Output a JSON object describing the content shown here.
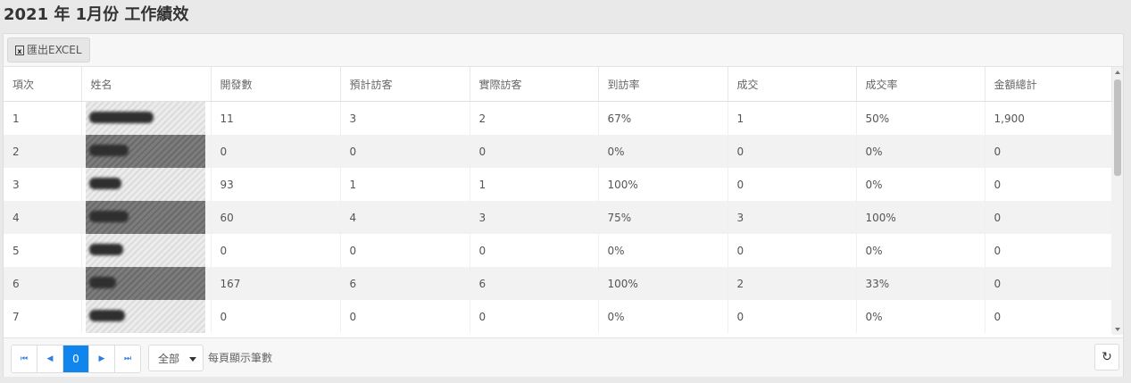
{
  "page": {
    "title": "2021 年 1月份 工作績效"
  },
  "toolbar": {
    "export_label": "匯出EXCEL",
    "export_icon": "x"
  },
  "table": {
    "columns": [
      "項次",
      "姓名",
      "開發數",
      "預計訪客",
      "實際訪客",
      "到訪率",
      "成交",
      "成交率",
      "金額總計"
    ],
    "rows": [
      {
        "no": "1",
        "dev": "11",
        "planned": "3",
        "actual": "2",
        "visit_rate": "67%",
        "deals": "1",
        "deal_rate": "50%",
        "amount": "1,900"
      },
      {
        "no": "2",
        "dev": "0",
        "planned": "0",
        "actual": "0",
        "visit_rate": "0%",
        "deals": "0",
        "deal_rate": "0%",
        "amount": "0"
      },
      {
        "no": "3",
        "dev": "93",
        "planned": "1",
        "actual": "1",
        "visit_rate": "100%",
        "deals": "0",
        "deal_rate": "0%",
        "amount": "0"
      },
      {
        "no": "4",
        "dev": "60",
        "planned": "4",
        "actual": "3",
        "visit_rate": "75%",
        "deals": "3",
        "deal_rate": "100%",
        "amount": "0"
      },
      {
        "no": "5",
        "dev": "0",
        "planned": "0",
        "actual": "0",
        "visit_rate": "0%",
        "deals": "0",
        "deal_rate": "0%",
        "amount": "0"
      },
      {
        "no": "6",
        "dev": "167",
        "planned": "6",
        "actual": "6",
        "visit_rate": "100%",
        "deals": "2",
        "deal_rate": "33%",
        "amount": "0"
      },
      {
        "no": "7",
        "dev": "0",
        "planned": "0",
        "actual": "0",
        "visit_rate": "0%",
        "deals": "0",
        "deal_rate": "0%",
        "amount": "0"
      }
    ]
  },
  "pagination": {
    "first_icon": "⏮",
    "prev_icon": "◀",
    "current_page": "0",
    "next_icon": "▶",
    "last_icon": "⏭",
    "page_size_value": "全部",
    "page_size_label": "每頁顯示筆數",
    "refresh_icon": "↻"
  }
}
